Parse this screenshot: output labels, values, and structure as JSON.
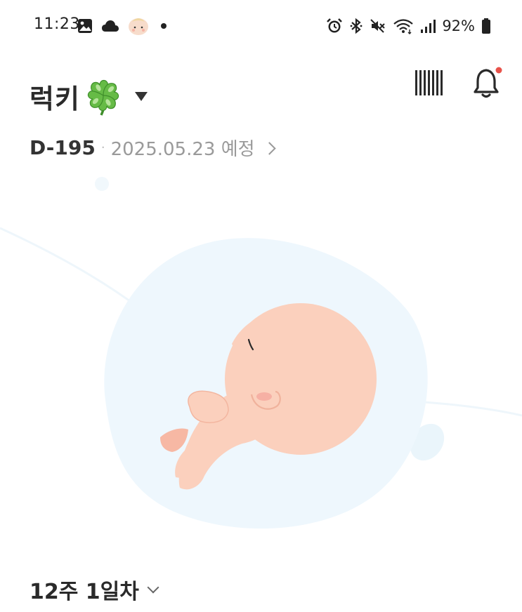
{
  "status_bar": {
    "time": "11:23",
    "battery_percent": "92%",
    "left_icons": [
      "gallery-icon",
      "cloud-icon",
      "baby-face-icon",
      "dot-icon"
    ],
    "right_icons": [
      "alarm-icon",
      "bluetooth-icon",
      "mute-icon",
      "wifi-icon",
      "signal-icon",
      "battery-icon"
    ]
  },
  "header": {
    "baby_name": "럭키",
    "name_emoji": "clover-icon",
    "notification_has_badge": true
  },
  "due": {
    "dday": "D-195",
    "separator": "·",
    "due_date_text": "2025.05.23 예정"
  },
  "week": {
    "label": "12주 1일차"
  },
  "colors": {
    "badge": "#e8524a",
    "bubble": "#eef7fd",
    "skin": "#fbd0bd",
    "cheek": "#f6b0a4"
  }
}
